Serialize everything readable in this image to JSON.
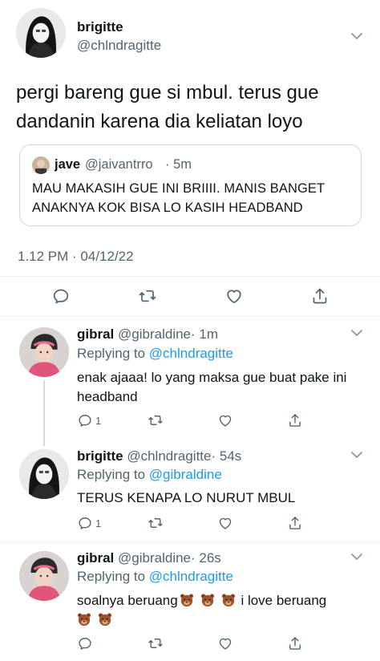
{
  "tweet": {
    "author_name": "brigitte",
    "author_handle": "@chlndragitte",
    "text": "pergi bareng gue si mbul. terus gue dandanin karena dia keliatan loyo",
    "quote": {
      "name": "jave",
      "handle": "@jaivantrro",
      "time": "· 5m",
      "text": "MAU MAKASIH GUE INI BRIIII. MANIS BANGET ANAKNYA KOK BISA LO KASIH HEADBAND"
    },
    "timestamp": "1.12 PM · 04/12/22"
  },
  "replies": [
    {
      "name": "gibral",
      "handle": "@gibraldine",
      "time": "· 1m",
      "replying_label": "Replying to",
      "replying_to": "@chlndragitte",
      "text": "enak ajaaa! lo yang maksa gue buat pake ini headband",
      "reply_count": "1"
    },
    {
      "name": "brigitte",
      "handle": "@chlndragitte",
      "time": "· 54s",
      "replying_label": "Replying to",
      "replying_to": "@gibraldine",
      "text": "TERUS KENAPA LO NURUT MBUL",
      "reply_count": "1"
    },
    {
      "name": "gibral",
      "handle": "@gibraldine",
      "time": "· 26s",
      "replying_label": "Replying to",
      "replying_to": "@chlndragitte",
      "text_before": "soalnya beruang",
      "text_after": " i love beruang",
      "emoji": "bear-face",
      "reply_count": ""
    }
  ],
  "icons": {
    "reply": "reply-icon",
    "retweet": "retweet-icon",
    "like": "heart-icon",
    "share": "share-icon",
    "more": "chevron-down-icon"
  },
  "colors": {
    "link": "#1d9bf0",
    "secondary_text": "#536471",
    "border": "#cfd9de"
  }
}
